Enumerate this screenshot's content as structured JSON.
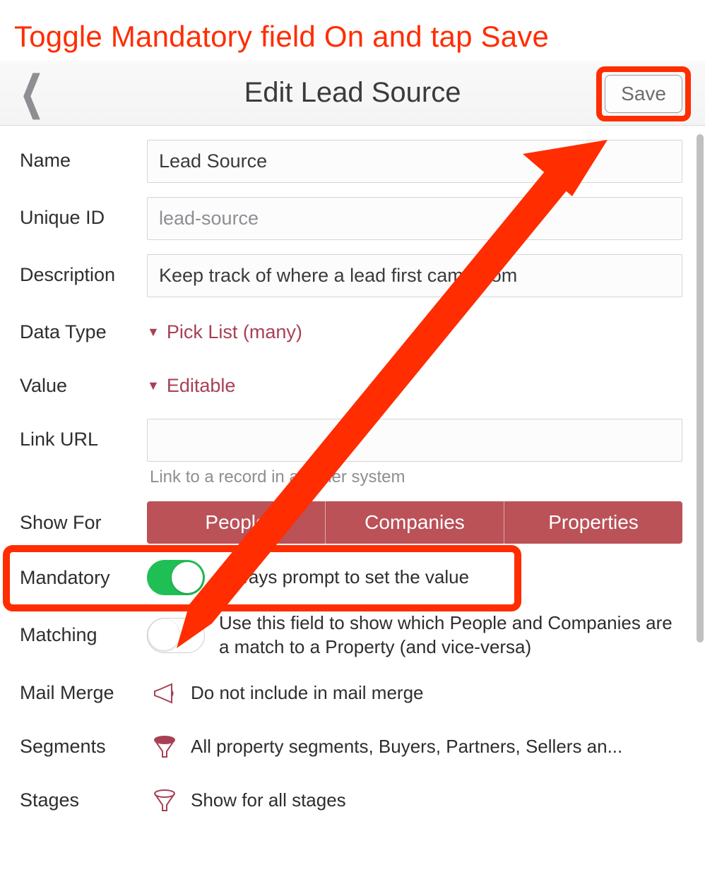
{
  "annotation_text": "Toggle Mandatory field On and tap Save",
  "header": {
    "title": "Edit Lead Source",
    "save_label": "Save"
  },
  "fields": {
    "name_label": "Name",
    "name_value": "Lead Source",
    "uniqueid_label": "Unique ID",
    "uniqueid_value": "lead-source",
    "description_label": "Description",
    "description_value": "Keep track of where a lead first came from",
    "datatype_label": "Data Type",
    "datatype_value": "Pick List (many)",
    "value_label": "Value",
    "value_value": "Editable",
    "linkurl_label": "Link URL",
    "linkurl_value": "",
    "linkurl_helper": "Link to a record in another system",
    "showfor_label": "Show For",
    "showfor_options": {
      "a": "People",
      "b": "Companies",
      "c": "Properties"
    },
    "mandatory_label": "Mandatory",
    "mandatory_text": "Always prompt to set the value",
    "matching_label": "Matching",
    "matching_text": "Use this field to show which People and Companies are a match to a Property (and vice-versa)",
    "mailmerge_label": "Mail Merge",
    "mailmerge_text": "Do not include in mail merge",
    "segments_label": "Segments",
    "segments_text": "All property segments, Buyers, Partners, Sellers an...",
    "stages_label": "Stages",
    "stages_text": "Show for all stages"
  },
  "colors": {
    "accent": "#a84055",
    "annotation": "#ff2d00",
    "segment_bg": "#ba5258",
    "toggle_on": "#20bf55"
  }
}
